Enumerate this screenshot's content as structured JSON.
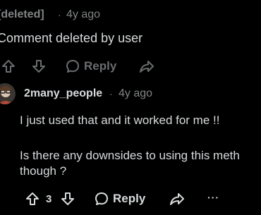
{
  "deleted_comment": {
    "author": "[deleted]",
    "separator": "·",
    "age": "4y ago",
    "body": "Comment deleted by user",
    "reply_label": "Reply"
  },
  "reply_comment": {
    "author": "2many_people",
    "separator": "·",
    "age": "4y ago",
    "body_lines": [
      "I just used that and it worked for me !!",
      "Is there any downsides to using this meth",
      "though ?"
    ],
    "vote_count": "3",
    "reply_label": "Reply",
    "more_label": "···"
  },
  "colors": {
    "background": "#000000",
    "text": "#d7dadc",
    "muted": "#818384",
    "dim_icon": "#6a6c6e"
  }
}
